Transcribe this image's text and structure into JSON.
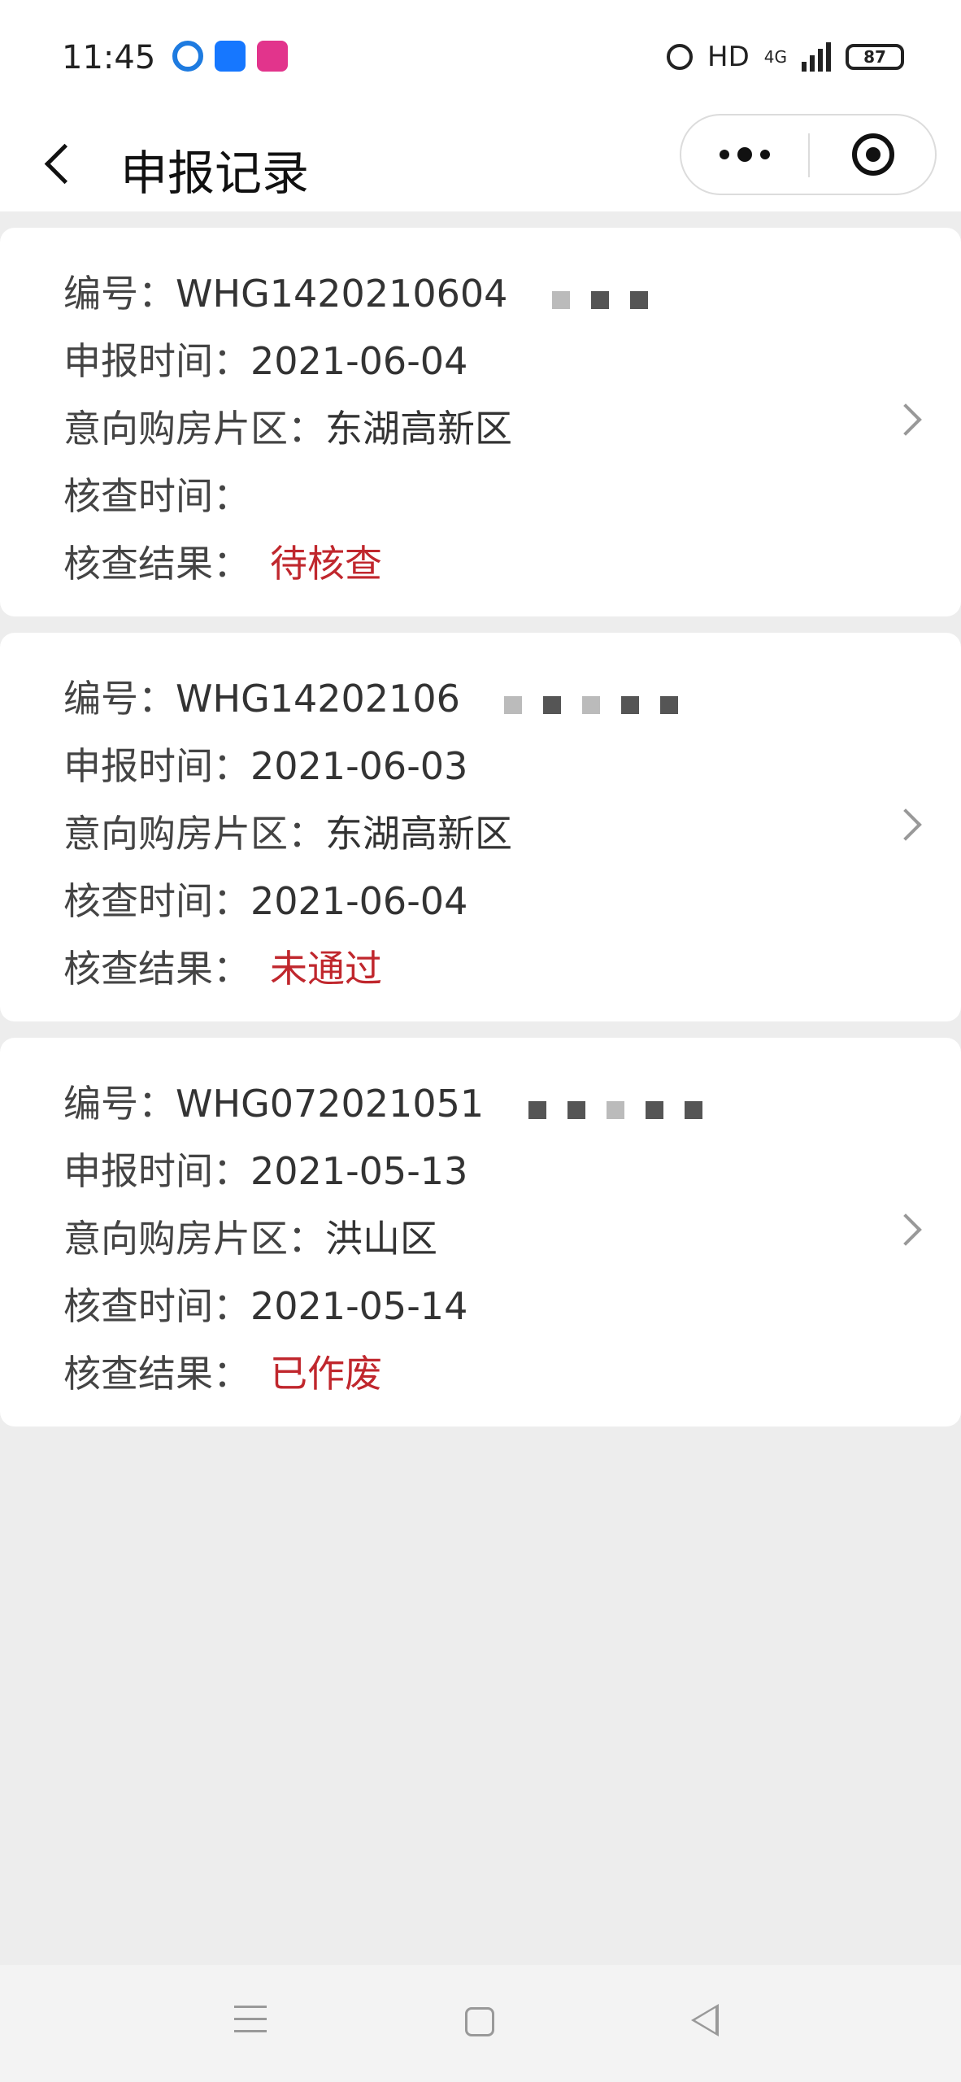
{
  "status_bar": {
    "time": "11:45",
    "hd": "HD",
    "network": "4G",
    "battery": "87",
    "icons": [
      "browser-icon",
      "alipay-icon",
      "app-icon",
      "alarm-icon",
      "signal-icon",
      "battery-icon"
    ]
  },
  "nav": {
    "title": "申报记录",
    "back_icon": "chevron-left-icon",
    "more_icon": "more-dots-icon",
    "close_icon": "target-close-icon"
  },
  "records": [
    {
      "id_label": "编号：",
      "id_value": "WHG1420210604",
      "report_time_label": "申报时间：",
      "report_time": "2021-06-04",
      "district_label": "意向购房片区：",
      "district": "东湖高新区",
      "check_time_label": "核查时间：",
      "check_time": "",
      "result_label": "核查结果：",
      "result": "待核查"
    },
    {
      "id_label": "编号：",
      "id_value": "WHG14202106",
      "report_time_label": "申报时间：",
      "report_time": "2021-06-03",
      "district_label": "意向购房片区：",
      "district": "东湖高新区",
      "check_time_label": "核查时间：",
      "check_time": "2021-06-04",
      "result_label": "核查结果：",
      "result": "未通过"
    },
    {
      "id_label": "编号：",
      "id_value": "WHG072021051",
      "report_time_label": "申报时间：",
      "report_time": "2021-05-13",
      "district_label": "意向购房片区：",
      "district": "洪山区",
      "check_time_label": "核查时间：",
      "check_time": "2021-05-14",
      "result_label": "核查结果：",
      "result": "已作废"
    }
  ],
  "colors": {
    "status_red": "#c0272d",
    "background": "#ededed",
    "card": "#ffffff"
  }
}
